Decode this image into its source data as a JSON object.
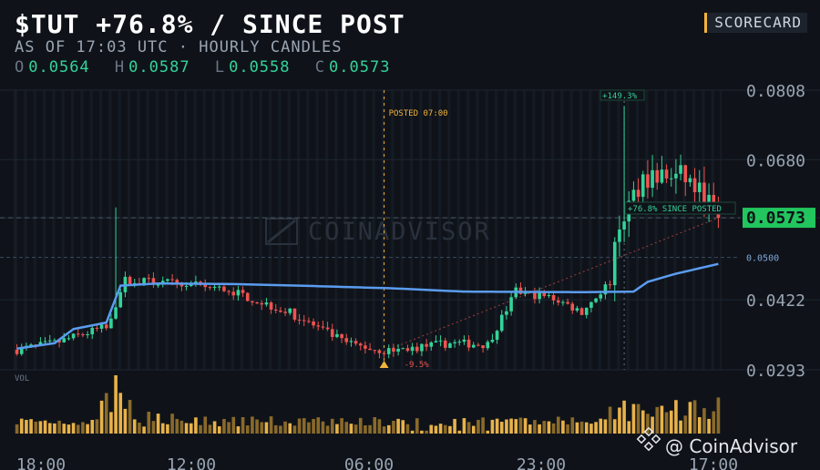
{
  "header": {
    "title": "$TUT +76.8% / SINCE POST",
    "subtitle": "AS OF 17:03 UTC · HOURLY CANDLES",
    "ohlc": {
      "o_label": "O",
      "o": "0.0564",
      "h_label": "H",
      "h": "0.0587",
      "l_label": "L",
      "l": "0.0558",
      "c_label": "C",
      "c": "0.0573"
    },
    "badge": "SCORECARD"
  },
  "colors": {
    "up": "#34d399",
    "down": "#ef5350",
    "ma": "#5b9cf0",
    "volume": "#e8b24a",
    "posted_line": "#f2b33d",
    "background": "#0f1319",
    "price_tag": "#22c55e"
  },
  "chart_data": {
    "type": "candlestick",
    "title": "$TUT +76.8% / SINCE POST",
    "ylim": [
      0.0293,
      0.0808
    ],
    "y_ticks": [
      "0.0808",
      "0.0680",
      "0.0573",
      "0.0422",
      "0.0293"
    ],
    "x_ticks": [
      "18:00",
      "12:00",
      "06:00",
      "23:00",
      "17:00"
    ],
    "candle_count": 150,
    "last_price": "0.0573",
    "ref_level": {
      "value": 0.05,
      "label": "0.0500"
    },
    "post_marker": {
      "label": "POSTED 07:00",
      "candle_index": 78,
      "price": 0.0327
    },
    "low_annotation": "-9.5%",
    "peak_annotation": "+149.3%",
    "peak_price": 0.0779,
    "since_posted_annotation": "+76.8% SINCE POSTED",
    "volume_label": "VOL",
    "watermark": "COINADVISOR",
    "credit": "@ CoinAdvisor",
    "segments": [
      {
        "start": 0,
        "end": 8,
        "open": 0.033,
        "close": 0.0342
      },
      {
        "start": 8,
        "end": 19,
        "open": 0.0342,
        "close": 0.0372
      },
      {
        "start": 19,
        "end": 23,
        "open": 0.0372,
        "close": 0.0458
      },
      {
        "start": 23,
        "end": 34,
        "open": 0.0458,
        "close": 0.0452
      },
      {
        "start": 34,
        "end": 45,
        "open": 0.0452,
        "close": 0.044
      },
      {
        "start": 45,
        "end": 58,
        "open": 0.044,
        "close": 0.0398
      },
      {
        "start": 58,
        "end": 70,
        "open": 0.0398,
        "close": 0.0342
      },
      {
        "start": 70,
        "end": 78,
        "open": 0.0342,
        "close": 0.0327
      },
      {
        "start": 78,
        "end": 92,
        "open": 0.0327,
        "close": 0.0342
      },
      {
        "start": 92,
        "end": 100,
        "open": 0.0342,
        "close": 0.034
      },
      {
        "start": 100,
        "end": 106,
        "open": 0.034,
        "close": 0.0437
      },
      {
        "start": 106,
        "end": 114,
        "open": 0.0437,
        "close": 0.0425
      },
      {
        "start": 114,
        "end": 120,
        "open": 0.0425,
        "close": 0.04
      },
      {
        "start": 120,
        "end": 126,
        "open": 0.04,
        "close": 0.0455
      },
      {
        "start": 126,
        "end": 128,
        "open": 0.0455,
        "close": 0.056
      },
      {
        "start": 128,
        "end": 133,
        "open": 0.056,
        "close": 0.065
      },
      {
        "start": 133,
        "end": 142,
        "open": 0.065,
        "close": 0.0648
      },
      {
        "start": 142,
        "end": 147,
        "open": 0.0648,
        "close": 0.06
      },
      {
        "start": 147,
        "end": 149,
        "open": 0.06,
        "close": 0.0573
      }
    ],
    "ma": [
      {
        "i": 0,
        "v": 0.0332
      },
      {
        "i": 8,
        "v": 0.0342
      },
      {
        "i": 12,
        "v": 0.0368
      },
      {
        "i": 19,
        "v": 0.038
      },
      {
        "i": 22,
        "v": 0.0448
      },
      {
        "i": 30,
        "v": 0.0452
      },
      {
        "i": 45,
        "v": 0.0451
      },
      {
        "i": 60,
        "v": 0.0448
      },
      {
        "i": 80,
        "v": 0.0443
      },
      {
        "i": 95,
        "v": 0.0437
      },
      {
        "i": 120,
        "v": 0.0436
      },
      {
        "i": 131,
        "v": 0.0437
      },
      {
        "i": 134,
        "v": 0.0455
      },
      {
        "i": 140,
        "v": 0.047
      },
      {
        "i": 149,
        "v": 0.0488
      }
    ]
  }
}
